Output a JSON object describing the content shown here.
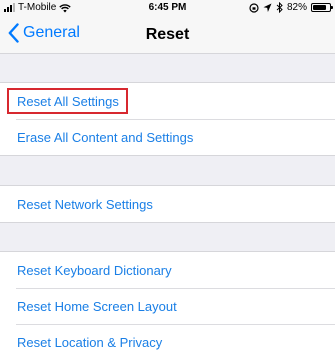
{
  "status_bar": {
    "carrier": "T-Mobile",
    "time": "6:45 PM",
    "battery": "82%",
    "battery_level": 0.82
  },
  "nav": {
    "back_label": "General",
    "title": "Reset"
  },
  "groups": [
    {
      "items": [
        "Reset All Settings",
        "Erase All Content and Settings"
      ]
    },
    {
      "items": [
        "Reset Network Settings"
      ]
    },
    {
      "items": [
        "Reset Keyboard Dictionary",
        "Reset Home Screen Layout",
        "Reset Location & Privacy"
      ]
    }
  ],
  "highlighted_item": "Reset All Settings",
  "colors": {
    "link": "#1a7fe6",
    "highlight_border": "#d7282f",
    "background": "#efeff4"
  }
}
